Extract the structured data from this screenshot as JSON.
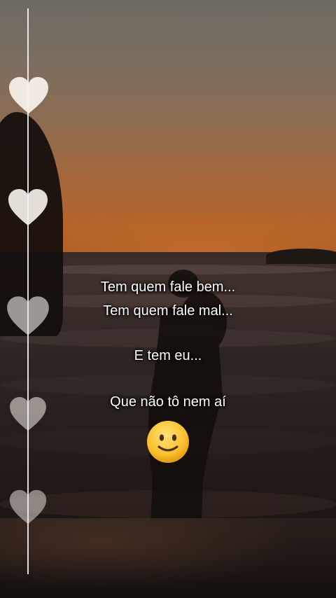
{
  "caption": {
    "line1": "Tem quem fale bem...",
    "line2": "Tem quem fale mal...",
    "line3": "E tem eu...",
    "line4": "Que não tô nem aí"
  },
  "decorations": {
    "line_color": "#ffffff",
    "heart_color": "#f5f0ea",
    "hearts": [
      {
        "icon": "heart-icon",
        "opacity": 0.95
      },
      {
        "icon": "heart-icon",
        "opacity": 0.92
      },
      {
        "icon": "heart-icon",
        "opacity": 0.6
      },
      {
        "icon": "heart-icon",
        "opacity": 0.55
      },
      {
        "icon": "heart-icon",
        "opacity": 0.5
      }
    ],
    "emoji": "slightly-smiling-face-icon"
  },
  "colors": {
    "sky_top": "#6e6a63",
    "sky_horizon": "#b4642a",
    "sea": "#2e2522",
    "text": "#ffffff"
  }
}
